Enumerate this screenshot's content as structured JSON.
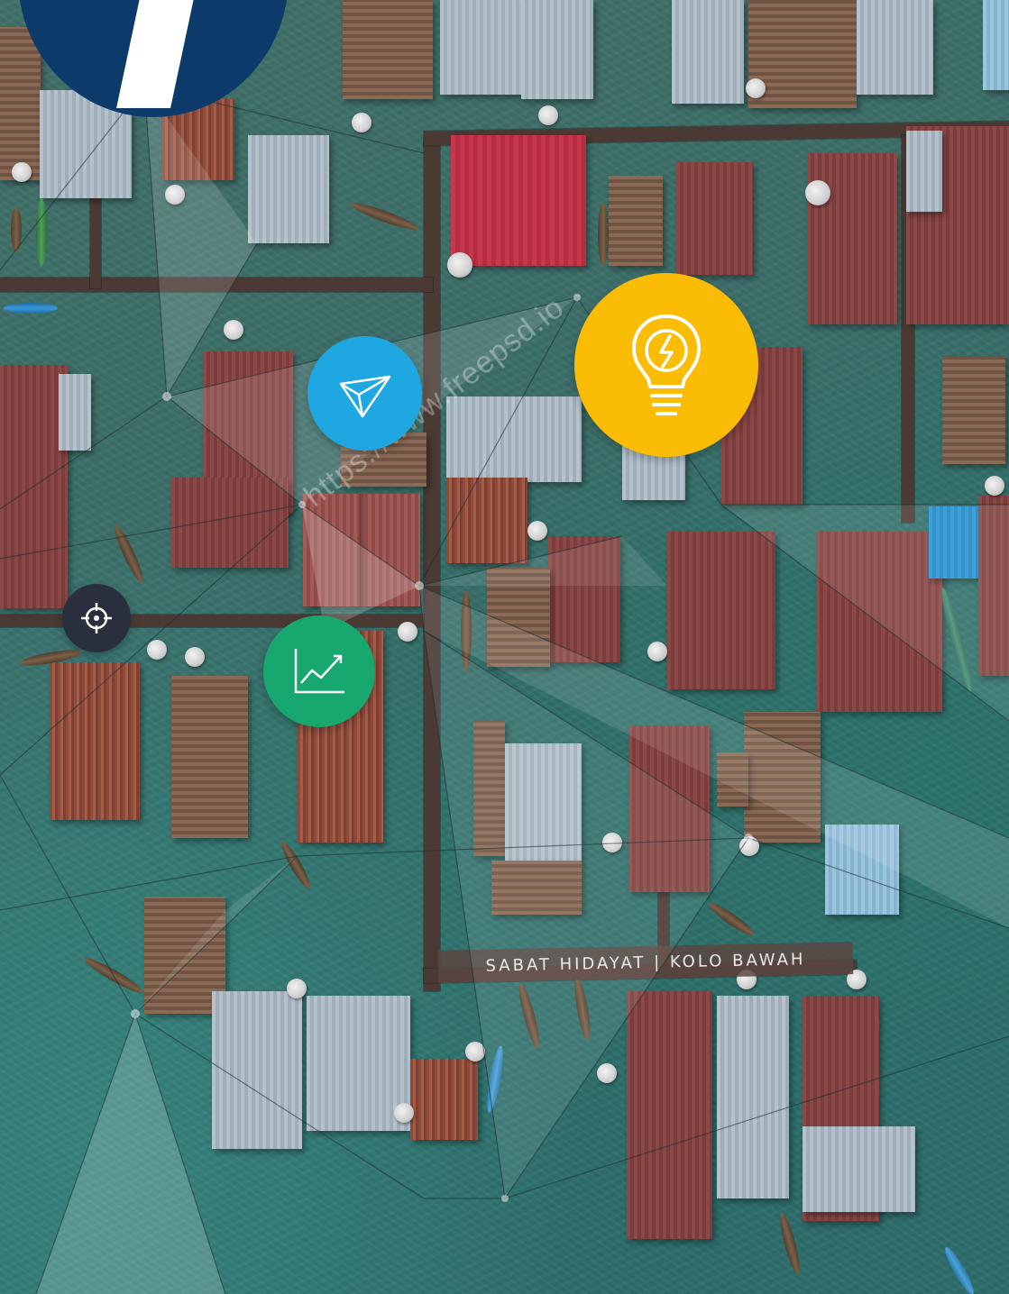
{
  "scene": {
    "sign_text": "SABAT HIDAYAT | KOLO BAWAH",
    "watermark_text": "https://www.freepsd.io"
  },
  "badges": [
    {
      "name": "target",
      "icon": "crosshair-icon",
      "color": "#2a2f3d"
    },
    {
      "name": "paper-plane",
      "icon": "paper-plane-icon",
      "color": "#1ea7e1"
    },
    {
      "name": "lightbulb",
      "icon": "lightbulb-icon",
      "color": "#fbbc05"
    },
    {
      "name": "trend",
      "icon": "chart-line-icon",
      "color": "#16a86f"
    }
  ],
  "colors": {
    "water": "#2f6c68",
    "logo_blue": "#0c3b6b",
    "network_line": "#1b2a30"
  }
}
